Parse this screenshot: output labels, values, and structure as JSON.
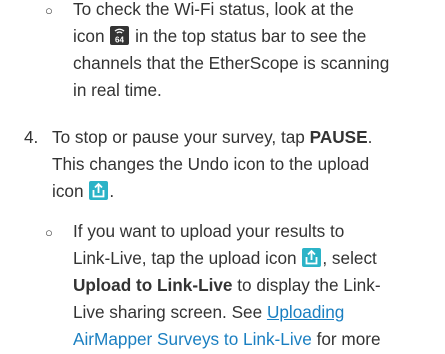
{
  "colors": {
    "text": "#333333",
    "link": "#1a7fc1",
    "icon_dark": "#333333",
    "icon_teal": "#2bb3c7"
  },
  "bullet_symbol": "○",
  "wifi_status": {
    "text_before": "To check the Wi-Fi status, look at the",
    "text_icon_before": "icon",
    "icon": "wifi-channel-scan-icon",
    "icon_channel": "64",
    "text_after": "in the top status bar to see the",
    "text_line3": "channels that the EtherScope is scanning",
    "text_line4": "in real time."
  },
  "step4": {
    "number": "4.",
    "line1_before": "To stop or pause your survey, tap",
    "pause_label": "PAUSE",
    "line1_after": ".",
    "line2": "This changes the Undo icon to the upload",
    "line3_before": "icon",
    "line3_icon": "upload-icon",
    "line3_after": "."
  },
  "upload_note": {
    "line1": "If you want to upload your results to",
    "line2_before": "Link-Live, tap the upload icon",
    "line2_icon": "upload-icon",
    "line2_after": ", select",
    "upload_bold": "Upload to Link-Live",
    "line3_after": "to display the Link-",
    "line4_before": "Live sharing screen. See",
    "link_part1": "Uploading",
    "link_part2": "AirMapper Surveys to Link-Live",
    "line5_after": "for more"
  }
}
